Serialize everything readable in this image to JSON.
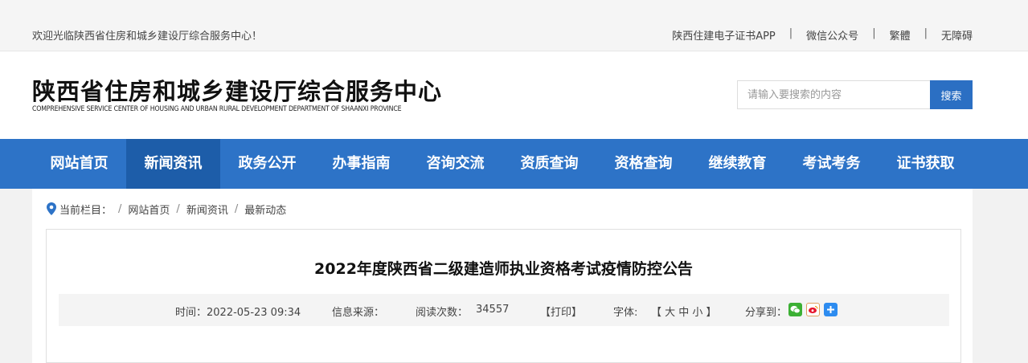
{
  "topbar": {
    "welcome": "欢迎光临陕西省住房和城乡建设厅综合服务中心！",
    "links": [
      "陕西住建电子证书APP",
      "微信公众号",
      "繁體",
      "无障碍"
    ],
    "separator": "|"
  },
  "header": {
    "title": "陕西省住房和城乡建设厅综合服务中心",
    "subtitle": "COMPREHENSIVE SERVICE CENTER OF HOUSING AND URBAN RURAL DEVELOPMENT DEPARTMENT OF SHAANXI PROVINCE",
    "search_placeholder": "请输入要搜索的内容",
    "search_button": "搜索"
  },
  "nav": {
    "items": [
      "网站首页",
      "新闻资讯",
      "政务公开",
      "办事指南",
      "咨询交流",
      "资质查询",
      "资格查询",
      "继续教育",
      "考试考务",
      "证书获取"
    ],
    "active_index": 1
  },
  "breadcrumb": {
    "label": "当前栏目：",
    "items": [
      "网站首页",
      "新闻资讯",
      "最新动态"
    ],
    "separator": "/"
  },
  "article": {
    "title": "2022年度陕西省二级建造师执业资格考试疫情防控公告",
    "time": "时间：2022-05-23 09:34",
    "source": "信息来源：",
    "views_label": "阅读次数：",
    "views": "34557",
    "print": "【打印】",
    "font_label": "字体:",
    "font_sizes": "【  大   中   小  】",
    "share_label": "分享到："
  },
  "colors": {
    "nav_bg": "#2d73c7",
    "nav_active": "#1d5da9",
    "search_button": "#2b6fc3"
  }
}
